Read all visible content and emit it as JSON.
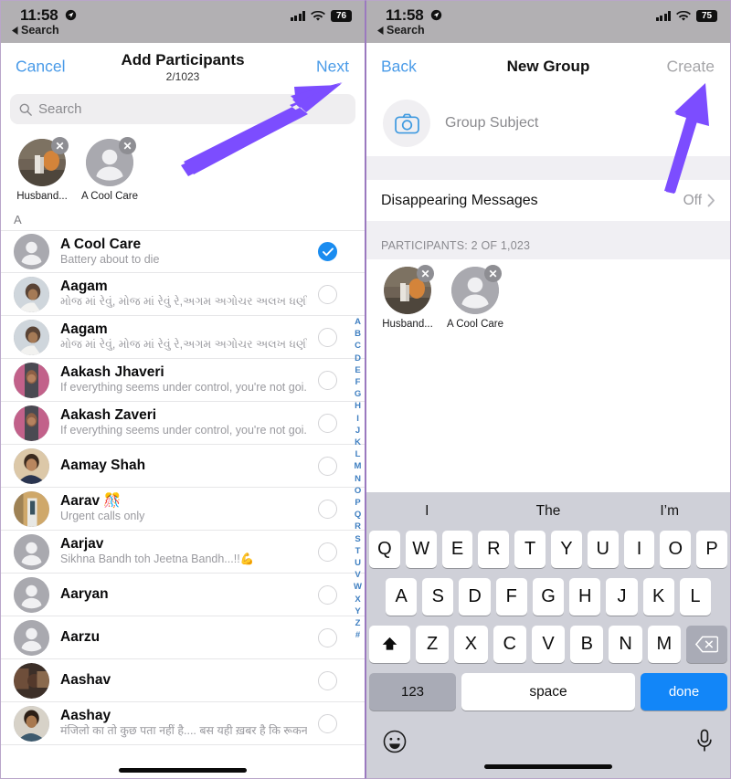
{
  "left_screen": {
    "status_bar": {
      "time": "11:58",
      "back_label": "Search",
      "battery": "76",
      "location_icon": "location-arrow-icon"
    },
    "nav": {
      "left_label": "Cancel",
      "title": "Add Participants",
      "subtitle": "2/1023",
      "right_label": "Next"
    },
    "search": {
      "placeholder": "Search",
      "icon": "search-icon"
    },
    "selected_chips": [
      {
        "name": "Husband...",
        "avatar": "photo"
      },
      {
        "name": "A Cool Care",
        "avatar": "placeholder"
      }
    ],
    "section_header": "A",
    "contacts": [
      {
        "name": "A Cool Care",
        "status": "Battery about to die",
        "selected": true,
        "avatar": "placeholder"
      },
      {
        "name": "Aagam",
        "status": "મોજ માં રેવું, મોજ માં રેવું રે,અગમ અગોચર અલખ ધણી ની ખોજ...",
        "selected": false,
        "avatar": "photo-man"
      },
      {
        "name": "Aagam",
        "status": "મોજ માં રેવું, મોજ માં રેવું રે,અગમ અગોચર અલખ ધણી ની ખોજ...",
        "selected": false,
        "avatar": "photo-man"
      },
      {
        "name": "Aakash Jhaveri",
        "status": "If everything seems under control, you're not goi...",
        "selected": false,
        "avatar": "photo-pink"
      },
      {
        "name": "Aakash Zaveri",
        "status": "If everything seems under control, you're not goi...",
        "selected": false,
        "avatar": "photo-pink"
      },
      {
        "name": "Aamay Shah",
        "status": "",
        "selected": false,
        "avatar": "photo-blue"
      },
      {
        "name": "Aarav 🎊",
        "status": "Urgent calls only",
        "selected": false,
        "avatar": "photo-tan"
      },
      {
        "name": "Aarjav",
        "status": "Sikhna Bandh toh Jeetna Bandh...!!💪",
        "selected": false,
        "avatar": "placeholder"
      },
      {
        "name": "Aaryan",
        "status": "",
        "selected": false,
        "avatar": "placeholder"
      },
      {
        "name": "Aarzu",
        "status": "",
        "selected": false,
        "avatar": "placeholder"
      },
      {
        "name": "Aashav",
        "status": "",
        "selected": false,
        "avatar": "photo-dark"
      },
      {
        "name": "Aashay",
        "status": "मंजिलो का तो कुछ पता नहीं है.... बस यही ख़बर है कि रूकना न...",
        "selected": false,
        "avatar": "photo-boy"
      }
    ],
    "alphabet_index": [
      "A",
      "B",
      "C",
      "D",
      "E",
      "F",
      "G",
      "H",
      "I",
      "J",
      "K",
      "L",
      "M",
      "N",
      "O",
      "P",
      "Q",
      "R",
      "S",
      "T",
      "U",
      "V",
      "W",
      "X",
      "Y",
      "Z",
      "#"
    ]
  },
  "right_screen": {
    "status_bar": {
      "time": "11:58",
      "back_label": "Search",
      "battery": "75",
      "location_icon": "location-arrow-icon"
    },
    "nav": {
      "left_label": "Back",
      "title": "New Group",
      "right_label": "Create"
    },
    "group_subject": {
      "placeholder": "Group Subject",
      "icon": "camera-icon"
    },
    "disappearing_messages": {
      "label": "Disappearing Messages",
      "value": "Off",
      "chevron": "chevron-right-icon"
    },
    "participants_header": "PARTICIPANTS: 2 OF 1,023",
    "participant_chips": [
      {
        "name": "Husband...",
        "avatar": "photo"
      },
      {
        "name": "A Cool Care",
        "avatar": "placeholder"
      }
    ],
    "keyboard": {
      "suggestions": [
        "I",
        "The",
        "I’m"
      ],
      "row1": [
        "Q",
        "W",
        "E",
        "R",
        "T",
        "Y",
        "U",
        "I",
        "O",
        "P"
      ],
      "row2": [
        "A",
        "S",
        "D",
        "F",
        "G",
        "H",
        "J",
        "K",
        "L"
      ],
      "row3": [
        "Z",
        "X",
        "C",
        "V",
        "B",
        "N",
        "M"
      ],
      "shift_icon": "shift-up-icon",
      "backspace_icon": "backspace-icon",
      "numbers_key": "123",
      "space_key": "space",
      "done_key": "done",
      "emoji_icon": "emoji-smiley-icon",
      "mic_icon": "microphone-icon"
    }
  },
  "annotations": {
    "accent_color": "#7c4dff",
    "arrows": [
      {
        "name": "next-button-arrow",
        "target": "Next"
      },
      {
        "name": "create-button-arrow",
        "target": "Create"
      }
    ]
  }
}
